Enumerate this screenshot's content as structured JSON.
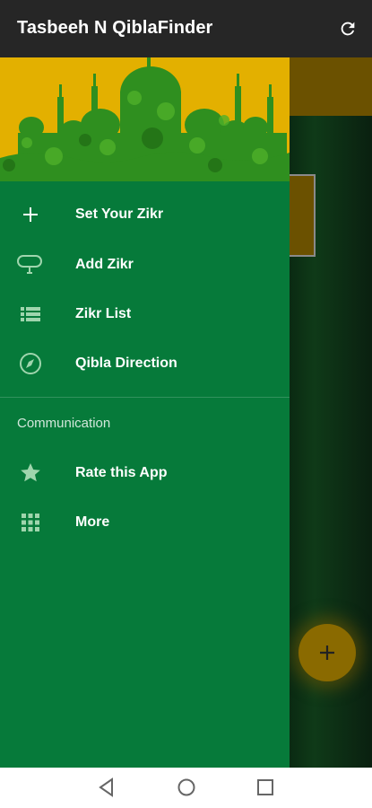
{
  "appbar": {
    "title": "Tasbeeh N QiblaFinder",
    "action_icon": "refresh-icon"
  },
  "drawer": {
    "items": [
      {
        "label": "Set Your Zikr",
        "icon": "plus-icon"
      },
      {
        "label": "Add Zikr",
        "icon": "tasbeeh-icon"
      },
      {
        "label": "Zikr List",
        "icon": "list-icon"
      },
      {
        "label": "Qibla Direction",
        "icon": "compass-icon"
      }
    ],
    "section_title": "Communication",
    "section_items": [
      {
        "label": "Rate this App",
        "icon": "star-icon"
      },
      {
        "label": "More",
        "icon": "grid-icon"
      }
    ]
  },
  "fab": {
    "icon": "plus-icon"
  },
  "navbar": {
    "icons": [
      "back-icon",
      "home-icon",
      "recents-icon"
    ]
  },
  "colors": {
    "appbar": "#262626",
    "drawer": "#067a3a",
    "header": "#e3b000",
    "mosque": "#2f8f1f"
  }
}
